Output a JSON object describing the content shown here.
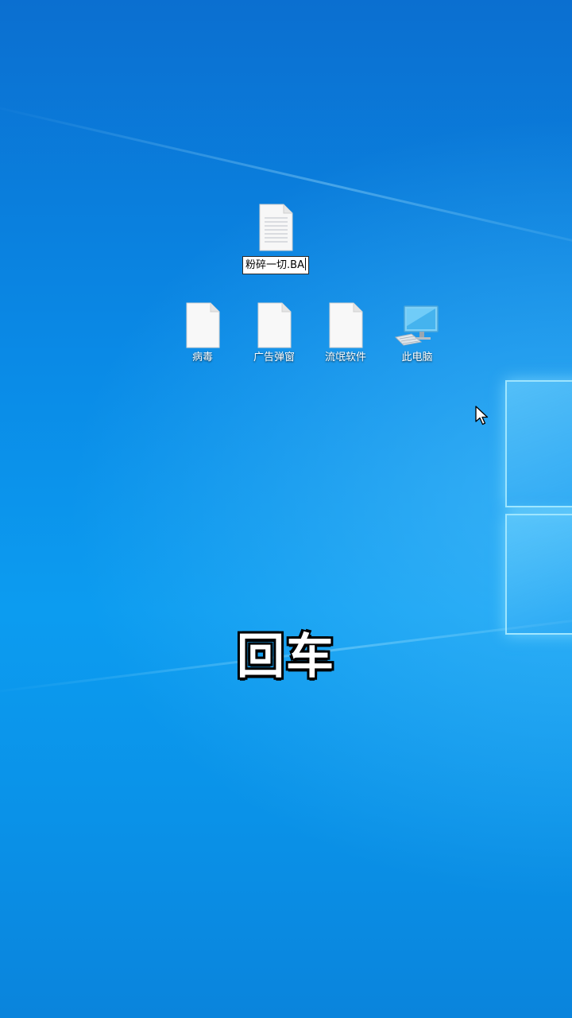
{
  "desktop": {
    "rename_icon": {
      "icon": "text-document-icon",
      "rename_value": "粉碎一切.BA"
    },
    "icons": [
      {
        "label": "病毒",
        "icon": "blank-file-icon"
      },
      {
        "label": "广告弹窗",
        "icon": "blank-file-icon"
      },
      {
        "label": "流氓软件",
        "icon": "blank-file-icon"
      },
      {
        "label": "此电脑",
        "icon": "computer-icon"
      }
    ]
  },
  "caption": {
    "text": "回车"
  },
  "colors": {
    "wallpaper": "#0a86d8",
    "caption_fill": "#ffffff",
    "caption_stroke": "#000000"
  }
}
